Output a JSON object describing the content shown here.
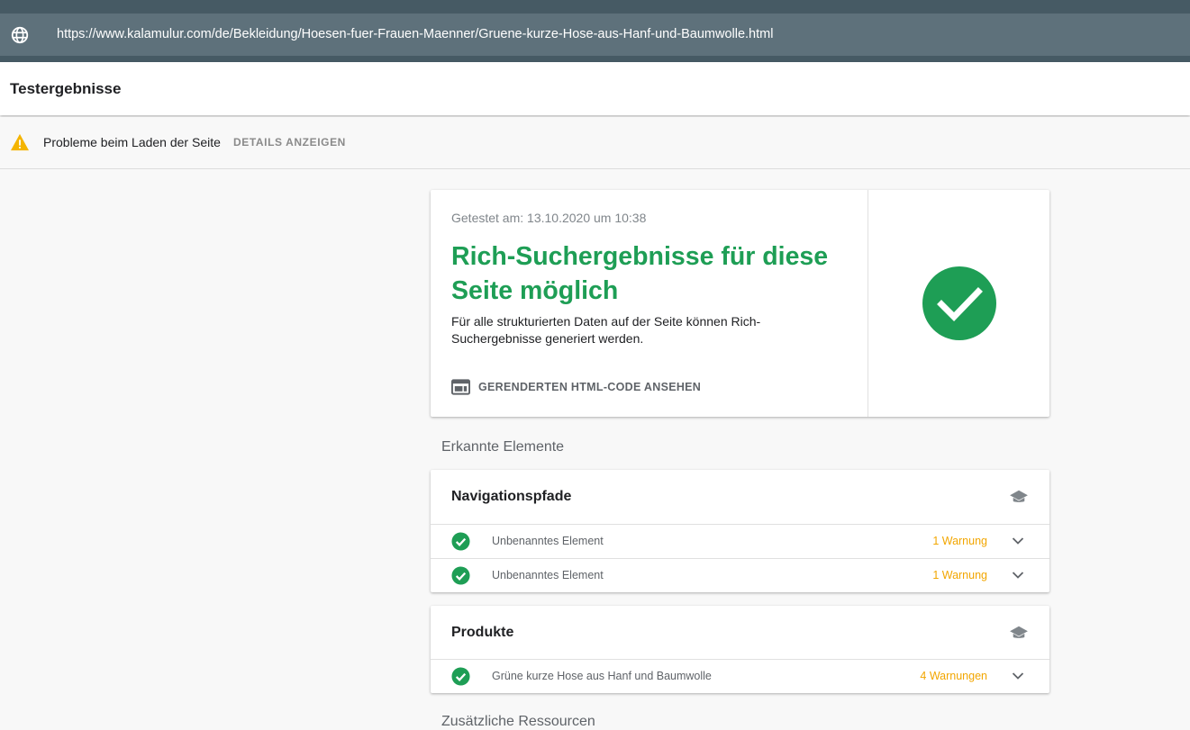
{
  "browser": {
    "url": "https://www.kalamulur.com/de/Bekleidung/Hoesen-fuer-Frauen-Maenner/Gruene-kurze-Hose-aus-Hanf-und-Baumwolle.html",
    "globe_icon": "globe-icon"
  },
  "header": {
    "title": "Testergebnisse"
  },
  "warning_bar": {
    "icon": "warning-icon",
    "message": "Probleme beim Laden der Seite",
    "details_label": "DETAILS ANZEIGEN",
    "icon_color": "#f4b400"
  },
  "result": {
    "tested_at": "Getestet am: 13.10.2020 um 10:38",
    "headline": "Rich-Suchergebnisse für diese Seite möglich",
    "description": "Für alle strukturierten Daten auf der Seite können Rich-Suchergebnisse generiert werden.",
    "html_link_label": "GERENDERTEN HTML-CODE ANSEHEN",
    "status_icon": "check-circle-icon",
    "accent_color": "#1e9e55"
  },
  "detected": {
    "label": "Erkannte Elemente",
    "groups": [
      {
        "title": "Navigationspfade",
        "icon": "graduation-cap-icon",
        "items": [
          {
            "name": "Unbenanntes Element",
            "warnings": "1 Warnung"
          },
          {
            "name": "Unbenanntes Element",
            "warnings": "1 Warnung"
          }
        ]
      },
      {
        "title": "Produkte",
        "icon": "graduation-cap-icon",
        "items": [
          {
            "name": "Grüne kurze Hose aus Hanf und Baumwolle",
            "warnings": "4 Warnungen"
          }
        ]
      }
    ]
  },
  "additional": {
    "label": "Zusätzliche Ressourcen"
  },
  "colors": {
    "warning_text": "#f2a600",
    "url_bar": "#5e717b",
    "top_bar": "#465a64"
  }
}
